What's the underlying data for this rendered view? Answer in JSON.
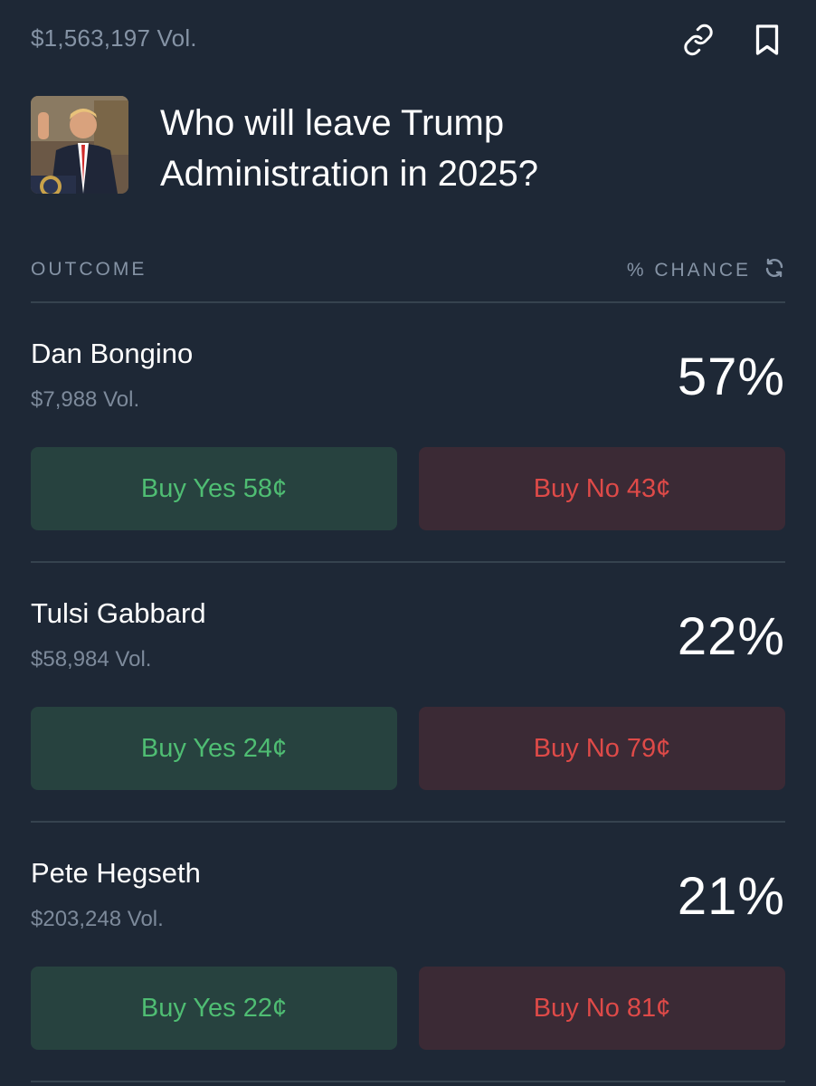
{
  "market": {
    "total_volume": "$1,563,197 Vol.",
    "title": "Who will leave Trump Administration in 2025?",
    "link_icon": "link-icon",
    "bookmark_icon": "bookmark-icon"
  },
  "columns": {
    "outcome": "OUTCOME",
    "chance": "% CHANCE",
    "refresh_icon": "refresh-icon"
  },
  "outcomes": [
    {
      "name": "Dan Bongino",
      "volume": "$7,988 Vol.",
      "chance": "57%",
      "buy_yes": "Buy Yes 58¢",
      "buy_no": "Buy No 43¢"
    },
    {
      "name": "Tulsi Gabbard",
      "volume": "$58,984 Vol.",
      "chance": "22%",
      "buy_yes": "Buy Yes 24¢",
      "buy_no": "Buy No 79¢"
    },
    {
      "name": "Pete Hegseth",
      "volume": "$203,248 Vol.",
      "chance": "21%",
      "buy_yes": "Buy Yes 22¢",
      "buy_no": "Buy No 81¢"
    }
  ],
  "colors": {
    "background": "#1e2836",
    "yes_text": "#4fbd73",
    "yes_bg": "#27423f",
    "no_text": "#de4a48",
    "no_bg": "#3b2a35",
    "muted": "#8593a5"
  }
}
